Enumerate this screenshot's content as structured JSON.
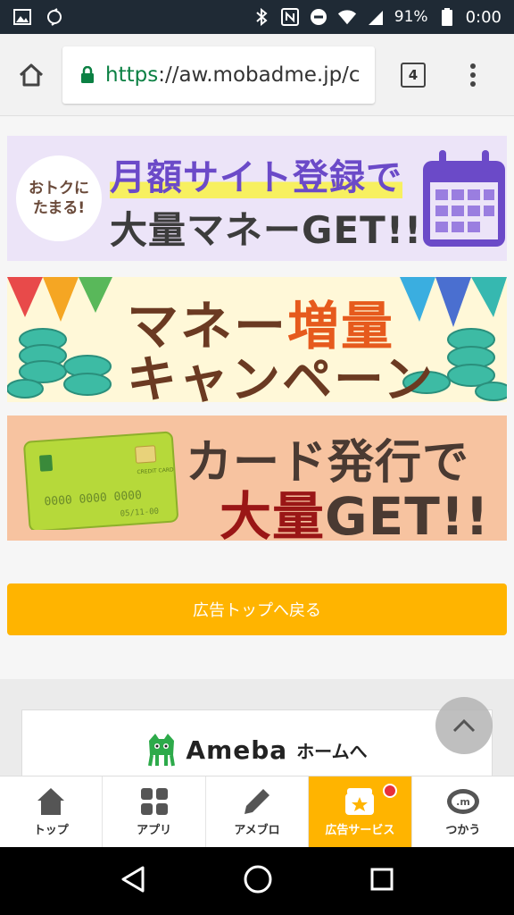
{
  "status_bar": {
    "battery": "91%",
    "time": "0:00"
  },
  "browser": {
    "url_scheme": "https",
    "url_rest": "://aw.mobadme.jp/c",
    "tab_count": "4"
  },
  "banners": {
    "monthly": {
      "badge_line1": "おトクに",
      "badge_line2": "たまる!",
      "title": "月額サイト登録で",
      "subtitle": "大量マネーGET!!"
    },
    "campaign": {
      "title_a": "マネー",
      "title_b": "増量",
      "title_line2": "キャンペーン"
    },
    "card": {
      "title_line1": "カード発行で",
      "title_line2_a": "大量",
      "title_line2_b": "GET!!",
      "card_number": "0000 0000 0000",
      "card_expiry": "05/11-00",
      "card_brand": "CREDIT CARD"
    }
  },
  "back_button": "広告トップへ戻る",
  "ameba": {
    "logo_text": "Ameba",
    "link_text": "ホームへ"
  },
  "bottom_nav": {
    "items": [
      {
        "label": "トップ",
        "icon": "home-icon"
      },
      {
        "label": "アプリ",
        "icon": "apps-icon"
      },
      {
        "label": "アメブロ",
        "icon": "pencil-icon"
      },
      {
        "label": "広告サービス",
        "icon": "ad-service-icon",
        "active": true
      },
      {
        "label": "つかう",
        "icon": "coin-icon"
      }
    ]
  },
  "colors": {
    "accent": "#ffb400",
    "status_bar": "#1f2a35",
    "badge": "#e8303a"
  }
}
